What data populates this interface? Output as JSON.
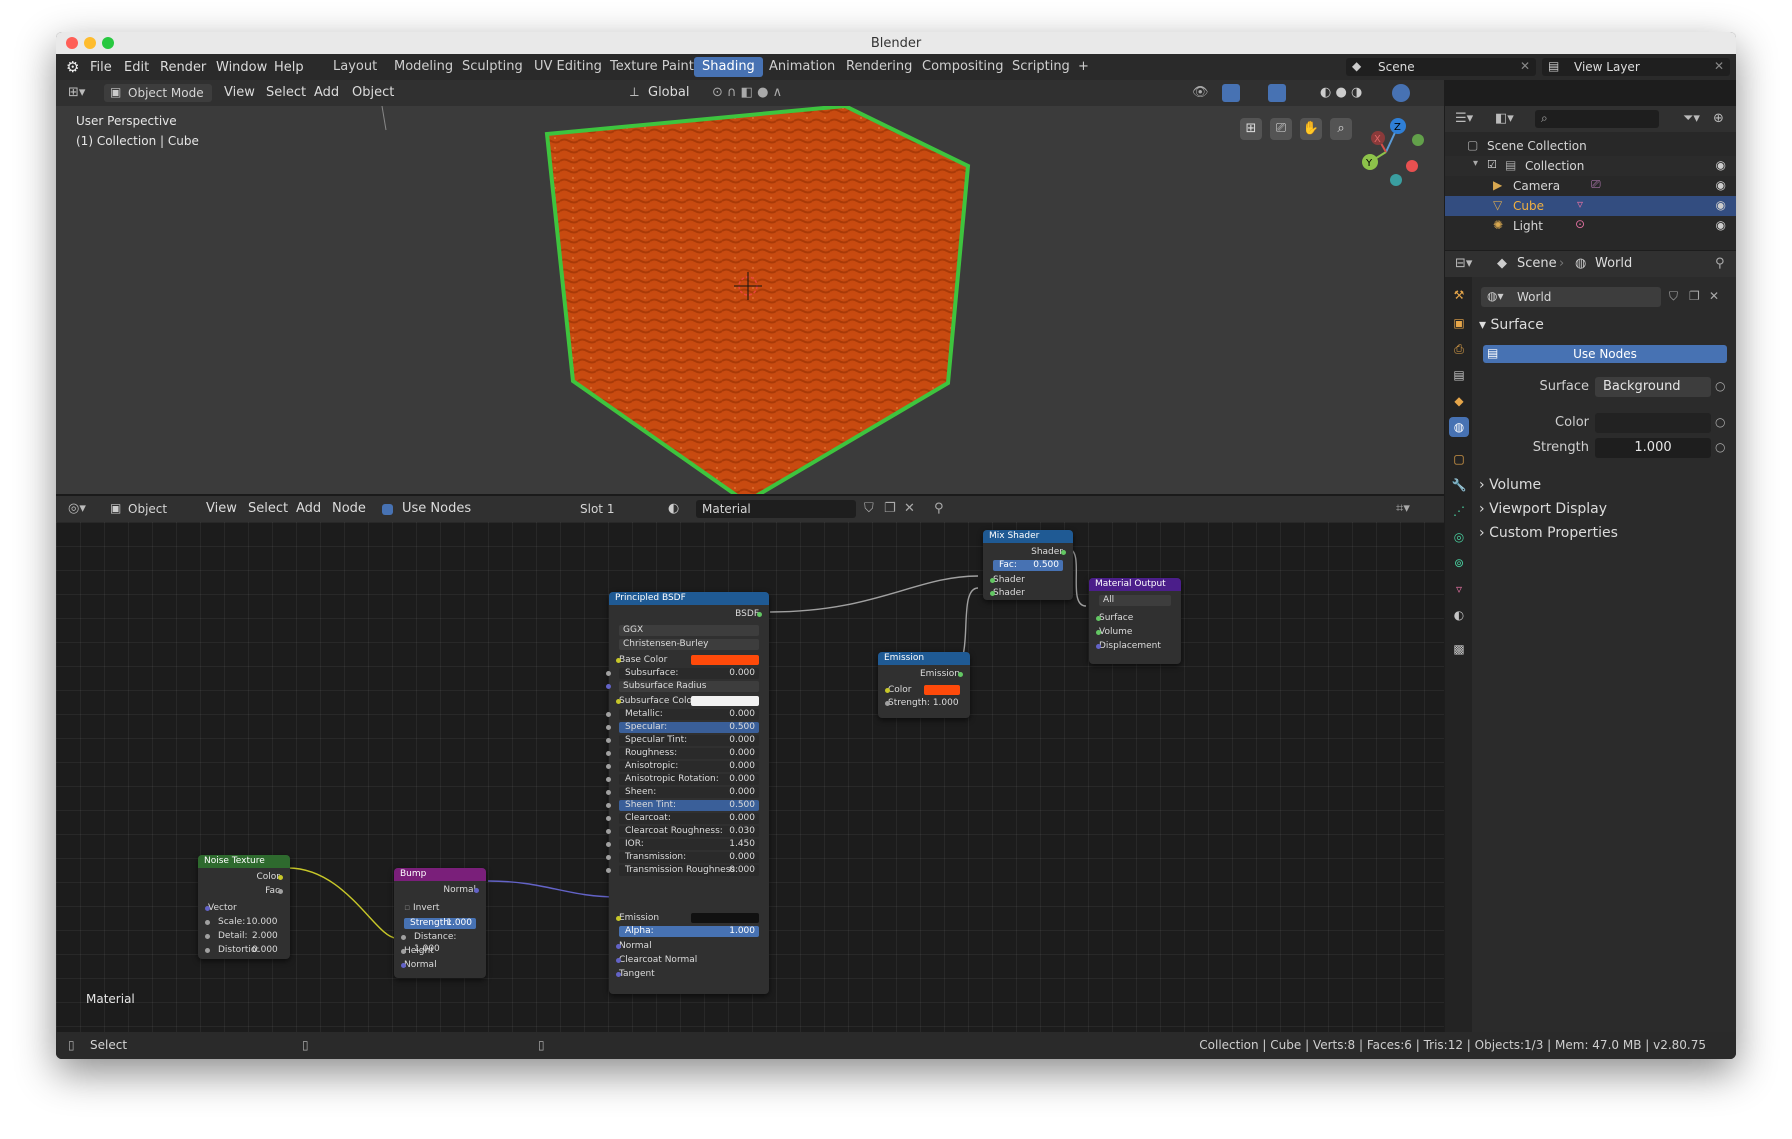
{
  "window": {
    "title": "Blender"
  },
  "menu": [
    "File",
    "Edit",
    "Render",
    "Window",
    "Help"
  ],
  "workspaces": [
    "Layout",
    "Modeling",
    "Sculpting",
    "UV Editing",
    "Texture Paint",
    "Shading",
    "Animation",
    "Rendering",
    "Compositing",
    "Scripting",
    "+"
  ],
  "active_workspace": "Shading",
  "top_right": {
    "scene": "Scene",
    "view_layer": "View Layer"
  },
  "viewport_header": {
    "mode": "Object Mode",
    "menus": [
      "View",
      "Select",
      "Add",
      "Object"
    ],
    "orientation": "Global"
  },
  "viewport": {
    "perspective": "User Perspective",
    "collection": "(1) Collection | Cube"
  },
  "gizmo": {
    "z": "Z",
    "y": "Y",
    "x": "X"
  },
  "node_header": {
    "editor_type": "Object",
    "menus": [
      "View",
      "Select",
      "Add",
      "Node"
    ],
    "use_nodes": "Use Nodes",
    "slot": "Slot 1",
    "material": "Material"
  },
  "node_editor_label": "Material",
  "nodes": {
    "mix": {
      "title": "Mix Shader",
      "out": "Shader",
      "fac_label": "Fac:",
      "fac": "0.500",
      "in1": "Shader",
      "in2": "Shader"
    },
    "output": {
      "title": "Material Output",
      "target": "All",
      "surface": "Surface",
      "volume": "Volume",
      "displacement": "Displacement"
    },
    "emission": {
      "title": "Emission",
      "out": "Emission",
      "color": "Color",
      "strength": "Strength: 1.000"
    },
    "bsdf": {
      "title": "Principled BSDF",
      "out": "BSDF",
      "dist": "GGX",
      "ss_method": "Christensen-Burley",
      "base_color": "Base Color",
      "ss_radius": "Subsurface Radius",
      "ss_color": "Subsurface Colo",
      "params": [
        {
          "label": "Subsurface:",
          "value": "0.000"
        },
        {
          "label": "Metallic:",
          "value": "0.000"
        },
        {
          "label": "Specular:",
          "value": "0.500"
        },
        {
          "label": "Specular Tint:",
          "value": "0.000"
        },
        {
          "label": "Roughness:",
          "value": "0.000"
        },
        {
          "label": "Anisotropic:",
          "value": "0.000"
        },
        {
          "label": "Anisotropic Rotation:",
          "value": "0.000"
        },
        {
          "label": "Sheen:",
          "value": "0.000"
        },
        {
          "label": "Sheen Tint:",
          "value": "0.500"
        },
        {
          "label": "Clearcoat:",
          "value": "0.000"
        },
        {
          "label": "Clearcoat Roughness:",
          "value": "0.030"
        },
        {
          "label": "IOR:",
          "value": "1.450"
        },
        {
          "label": "Transmission:",
          "value": "0.000"
        },
        {
          "label": "Transmission Roughness:",
          "value": "0.000"
        }
      ],
      "emission": "Emission",
      "alpha_label": "Alpha:",
      "alpha": "1.000",
      "normal": "Normal",
      "clearcoat_normal": "Clearcoat Normal",
      "tangent": "Tangent"
    },
    "noise": {
      "title": "Noise Texture",
      "color": "Color",
      "fac": "Fac",
      "vector": "Vector",
      "scale": "Scale:",
      "scale_v": "10.000",
      "detail": "Detail:",
      "detail_v": "2.000",
      "distortion": "Distortio:",
      "distortion_v": "0.000"
    },
    "bump": {
      "title": "Bump",
      "normal_out": "Normal",
      "invert": "Invert",
      "strength": "Strength:",
      "strength_v": "1.000",
      "distance": "Distance: 1.000",
      "height": "Height",
      "normal_in": "Normal"
    }
  },
  "outliner": {
    "root": "Scene Collection",
    "collection": "Collection",
    "items": [
      "Camera",
      "Cube",
      "Light"
    ]
  },
  "properties": {
    "breadcrumb_scene": "Scene",
    "breadcrumb_world": "World",
    "world_name": "World",
    "surface_section": "Surface",
    "use_nodes": "Use Nodes",
    "surface_label": "Surface",
    "surface_value": "Background",
    "color_label": "Color",
    "strength_label": "Strength",
    "strength_value": "1.000",
    "sections": [
      "Volume",
      "Viewport Display",
      "Custom Properties"
    ]
  },
  "status": {
    "left": "Select",
    "right": "Collection | Cube | Verts:8 | Faces:6 | Tris:12 | Objects:1/3 | Mem: 47.0 MB | v2.80.75"
  },
  "colors": {
    "accent": "#4772b3",
    "base_color": "#ff4a0a",
    "cube": "#c84a10",
    "cube_edge": "#3ec43e"
  },
  "icons": [
    "blender-logo-icon",
    "eye-icon",
    "camera-icon",
    "cube-icon",
    "light-icon",
    "world-icon",
    "pin-icon",
    "shield-icon",
    "search-icon",
    "filter-icon"
  ]
}
